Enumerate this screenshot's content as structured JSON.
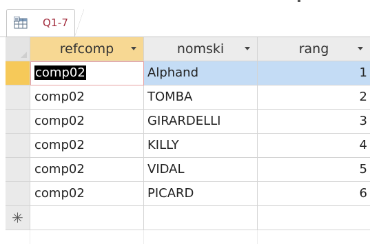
{
  "tab": {
    "label": "Q1-7",
    "icon": "query-icon",
    "label_color": "#a12a3b"
  },
  "columns": [
    {
      "label": "refcomp",
      "key": "refcomp",
      "has_dropdown": true
    },
    {
      "label": "nomski",
      "key": "nomski",
      "has_dropdown": true
    },
    {
      "label": "rang",
      "key": "rang",
      "has_dropdown": true
    }
  ],
  "rows": [
    {
      "refcomp": "comp02",
      "nomski": "Alphand",
      "rang": "1"
    },
    {
      "refcomp": "comp02",
      "nomski": "TOMBA",
      "rang": "2"
    },
    {
      "refcomp": "comp02",
      "nomski": "GIRARDELLI",
      "rang": "3"
    },
    {
      "refcomp": "comp02",
      "nomski": "KILLY",
      "rang": "4"
    },
    {
      "refcomp": "comp02",
      "nomski": "VIDAL",
      "rang": "5"
    },
    {
      "refcomp": "comp02",
      "nomski": "PICARD",
      "rang": "6"
    }
  ],
  "new_record_marker": "✳",
  "colors": {
    "header_bg": "#ececec",
    "active_header_bg": "#f7d893",
    "current_row_selector": "#f6c959",
    "current_row_highlight": "#c4dcf5",
    "selected_text_bg": "#000000",
    "grid_line": "#d4d4d4"
  }
}
